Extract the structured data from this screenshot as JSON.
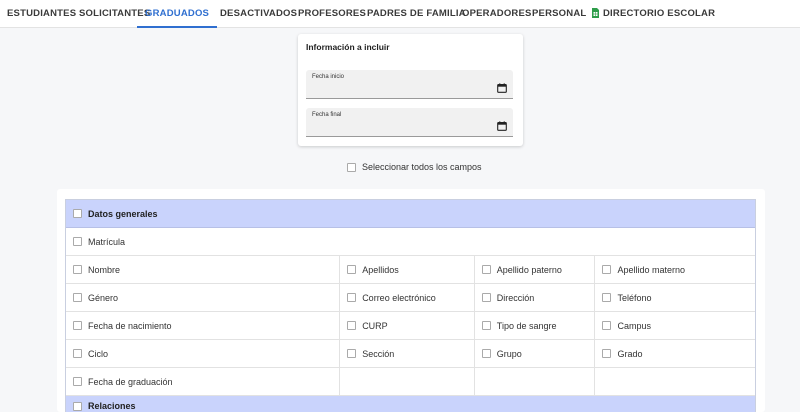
{
  "nav": {
    "tabs": [
      "ESTUDIANTES",
      "SOLICITANTES",
      "GRADUADOS",
      "DESACTIVADOS",
      "PROFESORES",
      "PADRES DE FAMILIA",
      "OPERADORES",
      "PERSONAL",
      "DIRECTORIO ESCOLAR"
    ],
    "active": "GRADUADOS"
  },
  "info": {
    "title": "Información a incluir",
    "start_label": "Fecha inicio",
    "end_label": "Fecha final"
  },
  "select_all_label": "Seleccionar todos los campos",
  "sections": {
    "general": "Datos generales",
    "relations": "Relaciones"
  },
  "fields": {
    "matricula": "Matrícula",
    "row1": [
      "Nombre",
      "Apellidos",
      "Apellido paterno",
      "Apellido materno"
    ],
    "row2": [
      "Género",
      "Correo electrónico",
      "Dirección",
      "Teléfono"
    ],
    "row3": [
      "Fecha de nacimiento",
      "CURP",
      "Tipo de sangre",
      "Campus"
    ],
    "row4": [
      "Ciclo",
      "Sección",
      "Grupo",
      "Grado"
    ],
    "row5": [
      "Fecha de graduación"
    ]
  },
  "colors": {
    "accent": "#2f6fd0",
    "section_bg": "#c9d3fc",
    "doc_icon": "#2e9d4a"
  }
}
